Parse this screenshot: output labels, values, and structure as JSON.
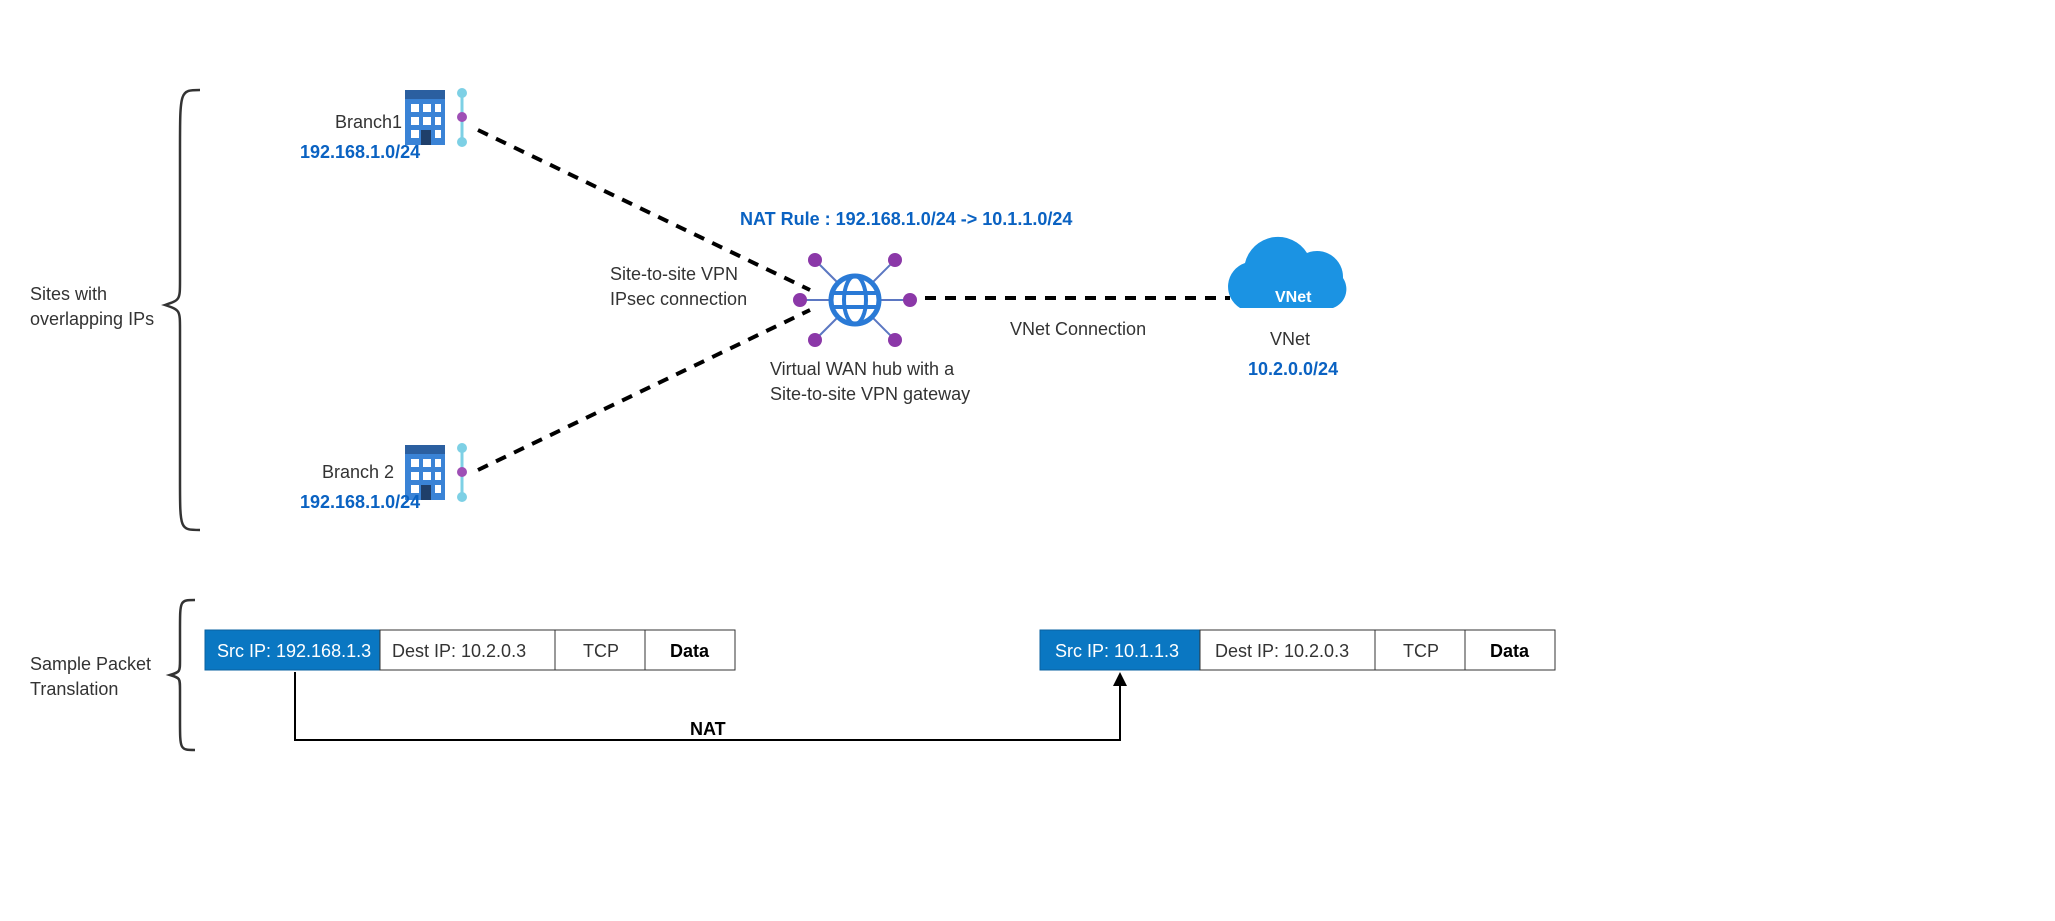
{
  "side_labels": {
    "sites_line1": "Sites with",
    "sites_line2": "overlapping IPs",
    "packet_line1": "Sample Packet",
    "packet_line2": "Translation"
  },
  "branch1": {
    "name": "Branch1",
    "ip": "192.168.1.0/24"
  },
  "branch2": {
    "name": "Branch 2",
    "ip": "192.168.1.0/24"
  },
  "vpn": {
    "line1": "Site-to-site VPN",
    "line2": "IPsec connection"
  },
  "natrule": {
    "text": "NAT Rule : 192.168.1.0/24  -> 10.1.1.0/24"
  },
  "hub": {
    "line1": "Virtual WAN hub with a",
    "line2": "Site-to-site VPN gateway"
  },
  "vnet_conn": {
    "text": "VNet Connection"
  },
  "vnet": {
    "cloud_text": "VNet",
    "label": "VNet",
    "ip": "10.2.0.0/24"
  },
  "packet_before": {
    "src": "Src IP: 192.168.1.3",
    "dest": "Dest IP: 10.2.0.3",
    "proto": "TCP",
    "data": "Data"
  },
  "packet_after": {
    "src": "Src IP: 10.1.1.3",
    "dest": "Dest IP: 10.2.0.3",
    "proto": "TCP",
    "data": "Data"
  },
  "nat_arrow_label": "NAT"
}
